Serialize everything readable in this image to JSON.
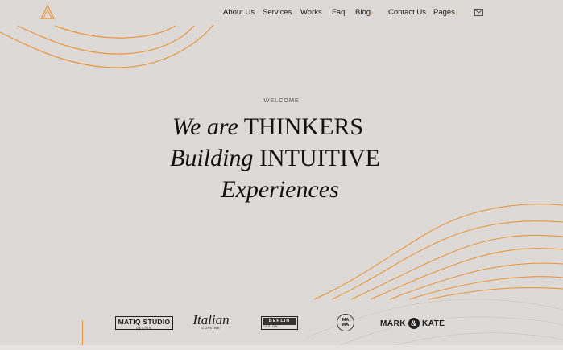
{
  "colors": {
    "background": "#dcd9d6",
    "accent": "#e8963a",
    "text": "#1a1a1a"
  },
  "logo": {
    "icon": "triangle-logo-icon"
  },
  "nav": {
    "about": "About Us",
    "services": "Services",
    "works": "Works",
    "faq": "Faq",
    "blog": "Blog",
    "contact": "Contact Us",
    "pages": "Pages",
    "chevron": "›",
    "mail_icon": "mail-icon"
  },
  "hero": {
    "kicker": "WELCOME",
    "line1_italic": "We are",
    "line1_caps": "THINKERS",
    "line2_italic": "Building",
    "line2_caps": "INTUITIVE",
    "line3_italic": "Experiences"
  },
  "brands": {
    "matiq": {
      "name": "MATIQ STUDIO",
      "sub": "DESIGN"
    },
    "italian": {
      "name": "Italian",
      "sub": "CUISINE"
    },
    "berlin": {
      "name": "BERLIN",
      "sub": "DESIGN"
    },
    "mama": {
      "line1": "MA",
      "line2": "MA"
    },
    "mark": {
      "left": "MARK",
      "amp": "&",
      "right": "KATE"
    }
  }
}
